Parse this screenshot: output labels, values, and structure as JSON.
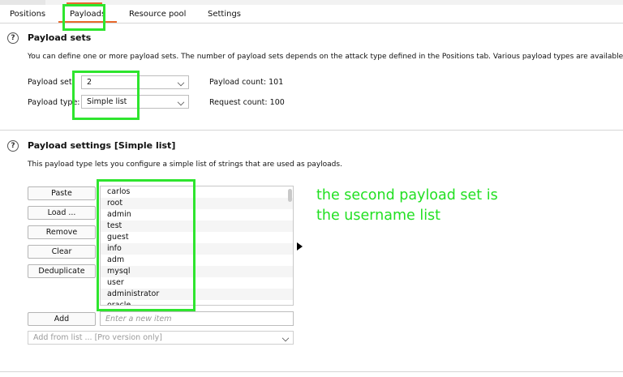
{
  "tabs": [
    {
      "label": "Positions"
    },
    {
      "label": "Payloads"
    },
    {
      "label": "Resource pool"
    },
    {
      "label": "Settings"
    }
  ],
  "payload_sets": {
    "title": "Payload sets",
    "description": "You can define one or more payload sets. The number of payload sets depends on the attack type defined in the Positions tab. Various payload types are available for",
    "payload_set_label": "Payload set:",
    "payload_set_value": "2",
    "payload_type_label": "Payload type:",
    "payload_type_value": "Simple list",
    "payload_count_label": "Payload count:",
    "payload_count_value": "101",
    "request_count_label": "Request count:",
    "request_count_value": "100"
  },
  "payload_settings": {
    "title": "Payload settings [Simple list]",
    "description": "This payload type lets you configure a simple list of strings that are used as payloads.",
    "buttons": {
      "paste": "Paste",
      "load": "Load ...",
      "remove": "Remove",
      "clear": "Clear",
      "deduplicate": "Deduplicate",
      "add": "Add"
    },
    "items": [
      "carlos",
      "root",
      "admin",
      "test",
      "guest",
      "info",
      "adm",
      "mysql",
      "user",
      "administrator",
      "oracle"
    ],
    "new_item_placeholder": "Enter a new item",
    "add_from_list": "Add from list ... [Pro version only]"
  },
  "annotation": {
    "line1": "the second payload set is",
    "line2": "the username list"
  },
  "colors": {
    "accent": "#e8692c",
    "highlight": "#2ee52e",
    "annotation_text": "#22e022"
  }
}
